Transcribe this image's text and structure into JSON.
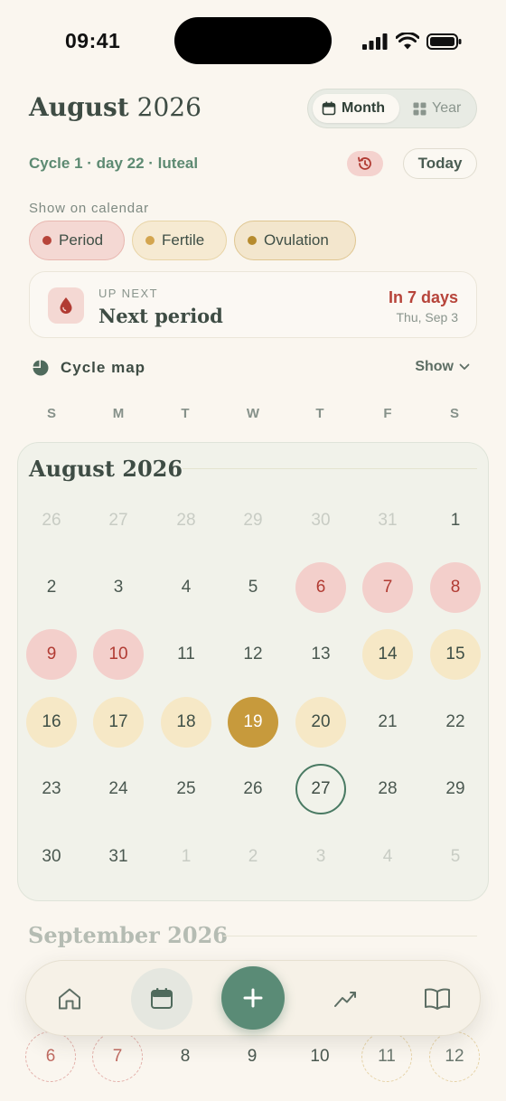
{
  "status_bar": {
    "time": "09:41"
  },
  "header": {
    "month": "August",
    "year": "2026",
    "view_toggle": {
      "month_label": "Month",
      "year_label": "Year",
      "selected": "Month"
    }
  },
  "cycle_info": "Cycle 1 · day 22 · luteal",
  "today_label": "Today",
  "show_on_calendar_label": "Show on calendar",
  "legend": {
    "period": "Period",
    "fertile": "Fertile",
    "ovulation": "Ovulation"
  },
  "up_next": {
    "label": "UP NEXT",
    "title": "Next period",
    "in_days": "In 7 days",
    "date": "Thu, Sep 3"
  },
  "cycle_map": {
    "label": "Cycle map",
    "toggle": "Show"
  },
  "weekdays": [
    "S",
    "M",
    "T",
    "W",
    "T",
    "F",
    "S"
  ],
  "calendar": {
    "title": "August 2026",
    "weeks": [
      [
        {
          "d": "26",
          "t": "other"
        },
        {
          "d": "27",
          "t": "other"
        },
        {
          "d": "28",
          "t": "other"
        },
        {
          "d": "29",
          "t": "other"
        },
        {
          "d": "30",
          "t": "other"
        },
        {
          "d": "31",
          "t": "other"
        },
        {
          "d": "1",
          "t": ""
        }
      ],
      [
        {
          "d": "2",
          "t": ""
        },
        {
          "d": "3",
          "t": ""
        },
        {
          "d": "4",
          "t": ""
        },
        {
          "d": "5",
          "t": ""
        },
        {
          "d": "6",
          "t": "period"
        },
        {
          "d": "7",
          "t": "period"
        },
        {
          "d": "8",
          "t": "period"
        }
      ],
      [
        {
          "d": "9",
          "t": "period"
        },
        {
          "d": "10",
          "t": "period"
        },
        {
          "d": "11",
          "t": ""
        },
        {
          "d": "12",
          "t": ""
        },
        {
          "d": "13",
          "t": ""
        },
        {
          "d": "14",
          "t": "fertile"
        },
        {
          "d": "15",
          "t": "fertile"
        }
      ],
      [
        {
          "d": "16",
          "t": "fertile"
        },
        {
          "d": "17",
          "t": "fertile"
        },
        {
          "d": "18",
          "t": "fertile"
        },
        {
          "d": "19",
          "t": "ovulation"
        },
        {
          "d": "20",
          "t": "fertile"
        },
        {
          "d": "21",
          "t": ""
        },
        {
          "d": "22",
          "t": ""
        }
      ],
      [
        {
          "d": "23",
          "t": ""
        },
        {
          "d": "24",
          "t": ""
        },
        {
          "d": "25",
          "t": ""
        },
        {
          "d": "26",
          "t": ""
        },
        {
          "d": "27",
          "t": "today"
        },
        {
          "d": "28",
          "t": ""
        },
        {
          "d": "29",
          "t": ""
        }
      ],
      [
        {
          "d": "30",
          "t": ""
        },
        {
          "d": "31",
          "t": ""
        },
        {
          "d": "1",
          "t": "other"
        },
        {
          "d": "2",
          "t": "other"
        },
        {
          "d": "3",
          "t": "other"
        },
        {
          "d": "4",
          "t": "other"
        },
        {
          "d": "5",
          "t": "other"
        }
      ]
    ]
  },
  "next_month": {
    "title": "September 2026",
    "days": [
      {
        "d": "6",
        "t": "pred-period"
      },
      {
        "d": "7",
        "t": "pred-period"
      },
      {
        "d": "8",
        "t": ""
      },
      {
        "d": "9",
        "t": ""
      },
      {
        "d": "10",
        "t": ""
      },
      {
        "d": "11",
        "t": "pred-fertile"
      },
      {
        "d": "12",
        "t": "pred-fertile"
      }
    ]
  },
  "tabs": [
    {
      "name": "home",
      "icon": "home-icon"
    },
    {
      "name": "calendar",
      "icon": "calendar-icon",
      "selected": true
    },
    {
      "name": "add",
      "icon": "plus-icon"
    },
    {
      "name": "trends",
      "icon": "trend-icon"
    },
    {
      "name": "learn",
      "icon": "book-icon"
    }
  ],
  "colors": {
    "accent": "#5a8b76",
    "period": "#b7443a",
    "fertile": "#d3a54f",
    "ovulation": "#c79a3c",
    "background": "#faf6ef"
  }
}
